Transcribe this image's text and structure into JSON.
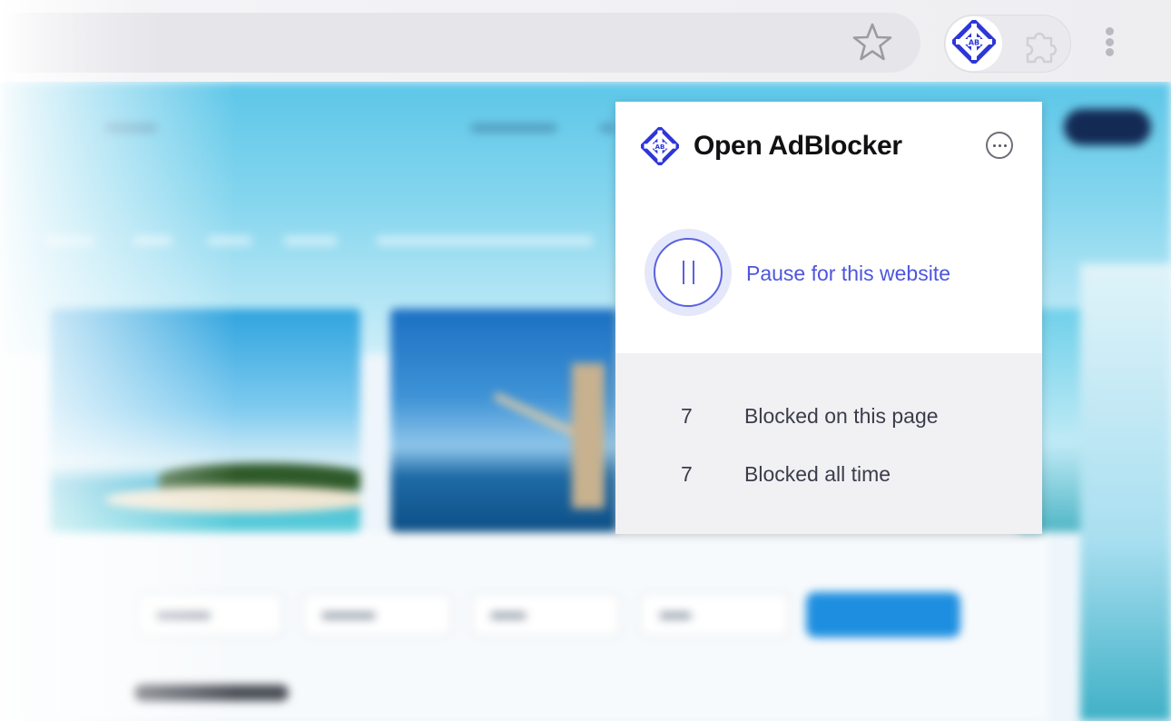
{
  "browser": {
    "bookmark_icon": "star-outline-icon",
    "extension_icon": "open-adblocker-logo-icon",
    "extensions_menu_icon": "puzzle-icon",
    "menu_icon": "vertical-dots-icon"
  },
  "popup": {
    "title": "Open AdBlocker",
    "logo_icon": "open-adblocker-logo-icon",
    "more_icon": "more-horizontal-icon",
    "pause": {
      "icon": "pause-icon",
      "label": "Pause for this website"
    },
    "stats": [
      {
        "count": "7",
        "label": "Blocked on this page"
      },
      {
        "count": "7",
        "label": "Blocked all time"
      }
    ]
  },
  "colors": {
    "accent": "#4e56dc",
    "logo_blue": "#2d36d8",
    "stats_background": "#f1f1f4",
    "title_text": "#111114"
  }
}
